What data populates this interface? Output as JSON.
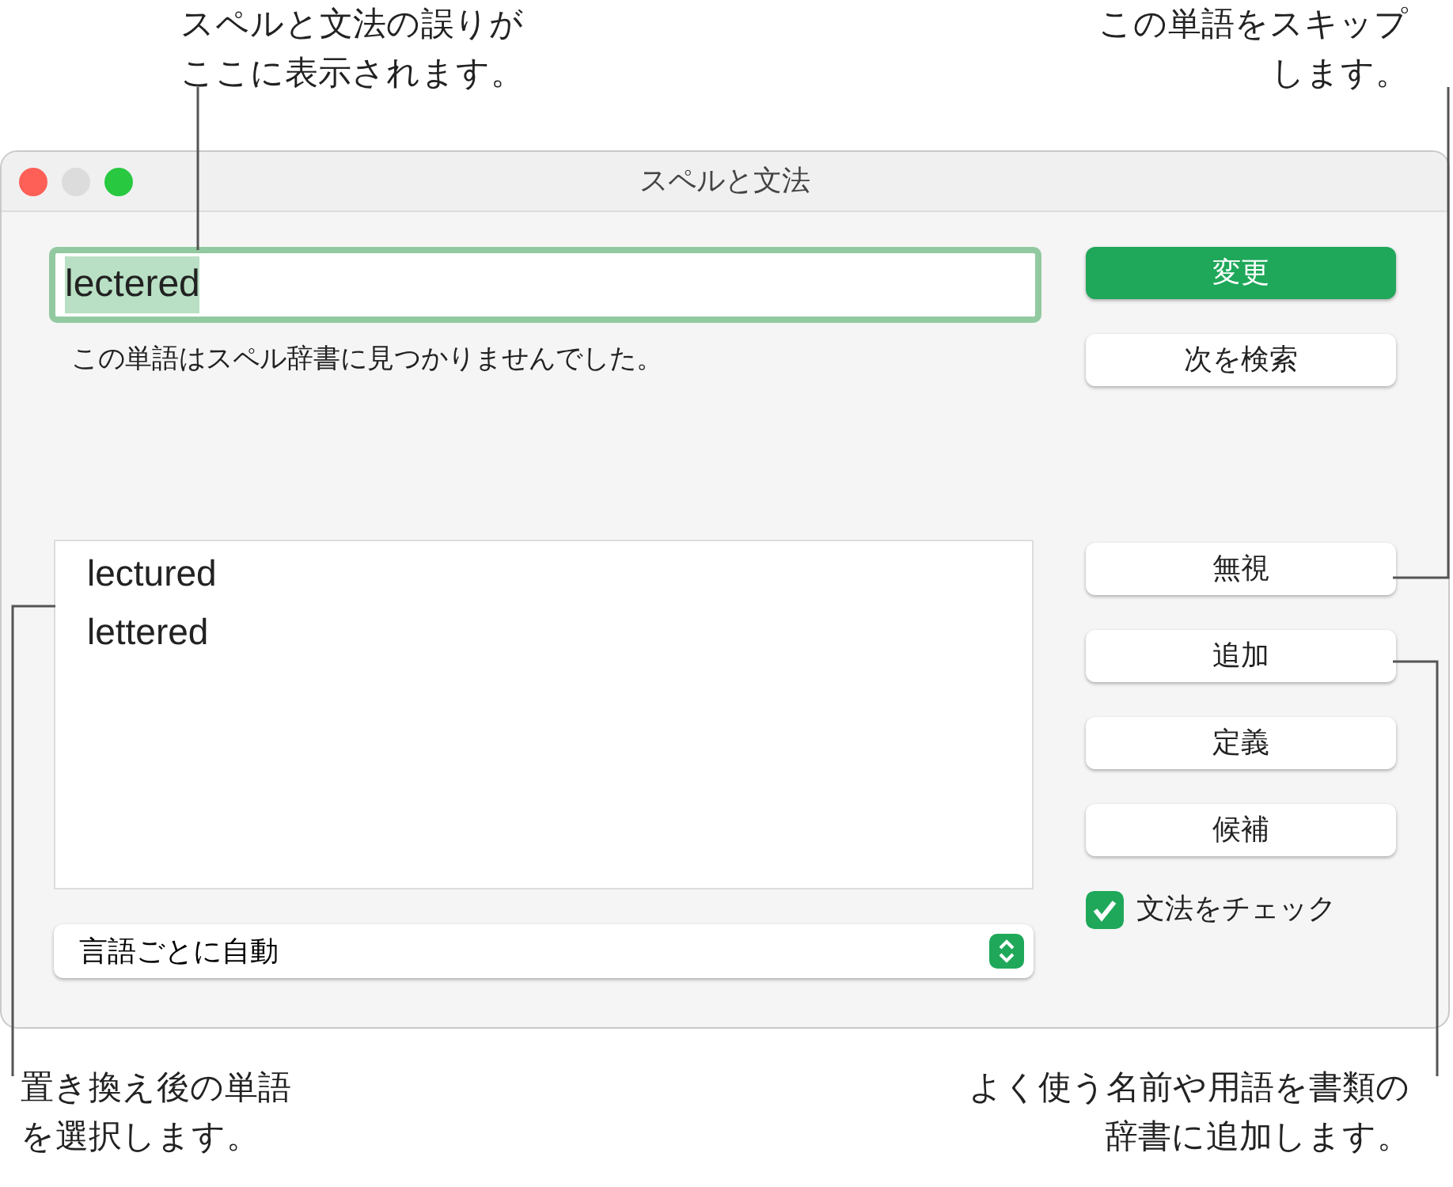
{
  "callouts": [
    {
      "kind": "top-left",
      "lines": [
        "スペルと文法の誤りが",
        "ここに表示されます。"
      ]
    },
    {
      "kind": "top-right",
      "lines": [
        "この単語をスキップ",
        "します。"
      ]
    },
    {
      "kind": "bottom-left",
      "lines": [
        "置き換え後の単語",
        "を選択します。"
      ]
    },
    {
      "kind": "bottom-right",
      "lines": [
        "よく使う名前や用語を書類の",
        "辞書に追加します。"
      ]
    }
  ],
  "window": {
    "title": "スペルと文法",
    "word_field": {
      "value": "lectered",
      "text_selected": true
    },
    "message": "この単語はスペル辞書に見つかりませんでした。",
    "top_buttons": [
      {
        "label": "変更",
        "kind": "primary"
      },
      {
        "label": "次を検索",
        "kind": "default"
      }
    ],
    "side_buttons": [
      {
        "label": "無視",
        "kind": "default"
      },
      {
        "label": "追加",
        "kind": "default"
      },
      {
        "label": "定義",
        "kind": "default"
      },
      {
        "label": "候補",
        "kind": "default"
      }
    ],
    "suggestions": [
      {
        "text": "lectured",
        "selected": false
      },
      {
        "text": "lettered",
        "selected": false
      }
    ],
    "language_popup": {
      "value": "言語ごとに自動"
    },
    "grammar_checkbox": {
      "label": "文法をチェック",
      "checked": true
    }
  }
}
